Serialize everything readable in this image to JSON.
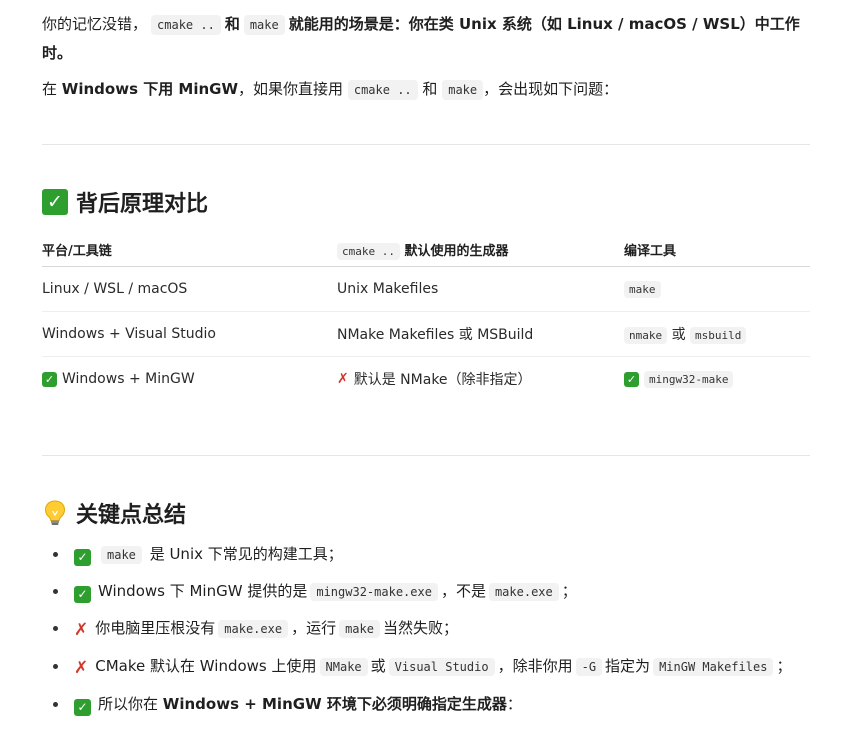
{
  "intro": {
    "p1_a": "你的记忆没错，",
    "p1_code1": "cmake ..",
    "p1_and": "和",
    "p1_code2": "make",
    "p1_b": "就能用的场景是：你在类 Unix 系统（如 Linux / macOS / WSL）中工作时。",
    "p2_a": "在",
    "p2_bold": "Windows 下用 MinGW",
    "p2_b": "，如果你直接用",
    "p2_code1": "cmake ..",
    "p2_and": "和",
    "p2_code2": "make",
    "p2_c": "，会出现如下问题："
  },
  "section1": {
    "icon": "check-mark-button-icon",
    "title": "背后原理对比",
    "headers": {
      "col1": "平台/工具链",
      "col2_code": "cmake ..",
      "col2_text": "默认使用的生成器",
      "col3": "编译工具"
    },
    "rows": [
      {
        "platform": "Linux / WSL / macOS",
        "generator": "Unix Makefiles",
        "tool1": "make"
      },
      {
        "platform": "Windows + Visual Studio",
        "generator": "NMake Makefiles 或 MSBuild",
        "tool1": "nmake",
        "or": "或",
        "tool2": "msbuild"
      },
      {
        "platform": "Windows + MinGW",
        "generator": "默认是 NMake（除非指定）",
        "tool1": "mingw32-make"
      }
    ]
  },
  "section2": {
    "icon": "light-bulb-icon",
    "title": "关键点总结",
    "items": [
      {
        "icon": "check-mark-button-icon",
        "code1": "make",
        "text1": "是 Unix 下常见的构建工具；"
      },
      {
        "icon": "check-mark-button-icon",
        "text1": "Windows 下 MinGW 提供的是",
        "code1": "mingw32-make.exe",
        "text2": "，不是",
        "code2": "make.exe",
        "text3": "；"
      },
      {
        "icon": "cross-mark-icon",
        "text1": "你电脑里压根没有",
        "code1": "make.exe",
        "text2": "，运行",
        "code2": "make",
        "text3": "当然失败；"
      },
      {
        "icon": "cross-mark-icon",
        "text1": "CMake 默认在 Windows 上使用",
        "code1": "NMake",
        "text2": "或",
        "code2": "Visual Studio",
        "text3": "，除非你用",
        "code3": "-G",
        "text4": "指定为",
        "code4": "MinGW Makefiles",
        "text5": "；"
      },
      {
        "icon": "check-mark-button-icon",
        "text1": "所以你在",
        "bold": "Windows + MinGW 环境下必须明确指定生成器",
        "text2": "："
      }
    ]
  },
  "colors": {
    "check": "#2e9e2e",
    "cross": "#d2372c",
    "code_bg": "#f2f2f2"
  }
}
